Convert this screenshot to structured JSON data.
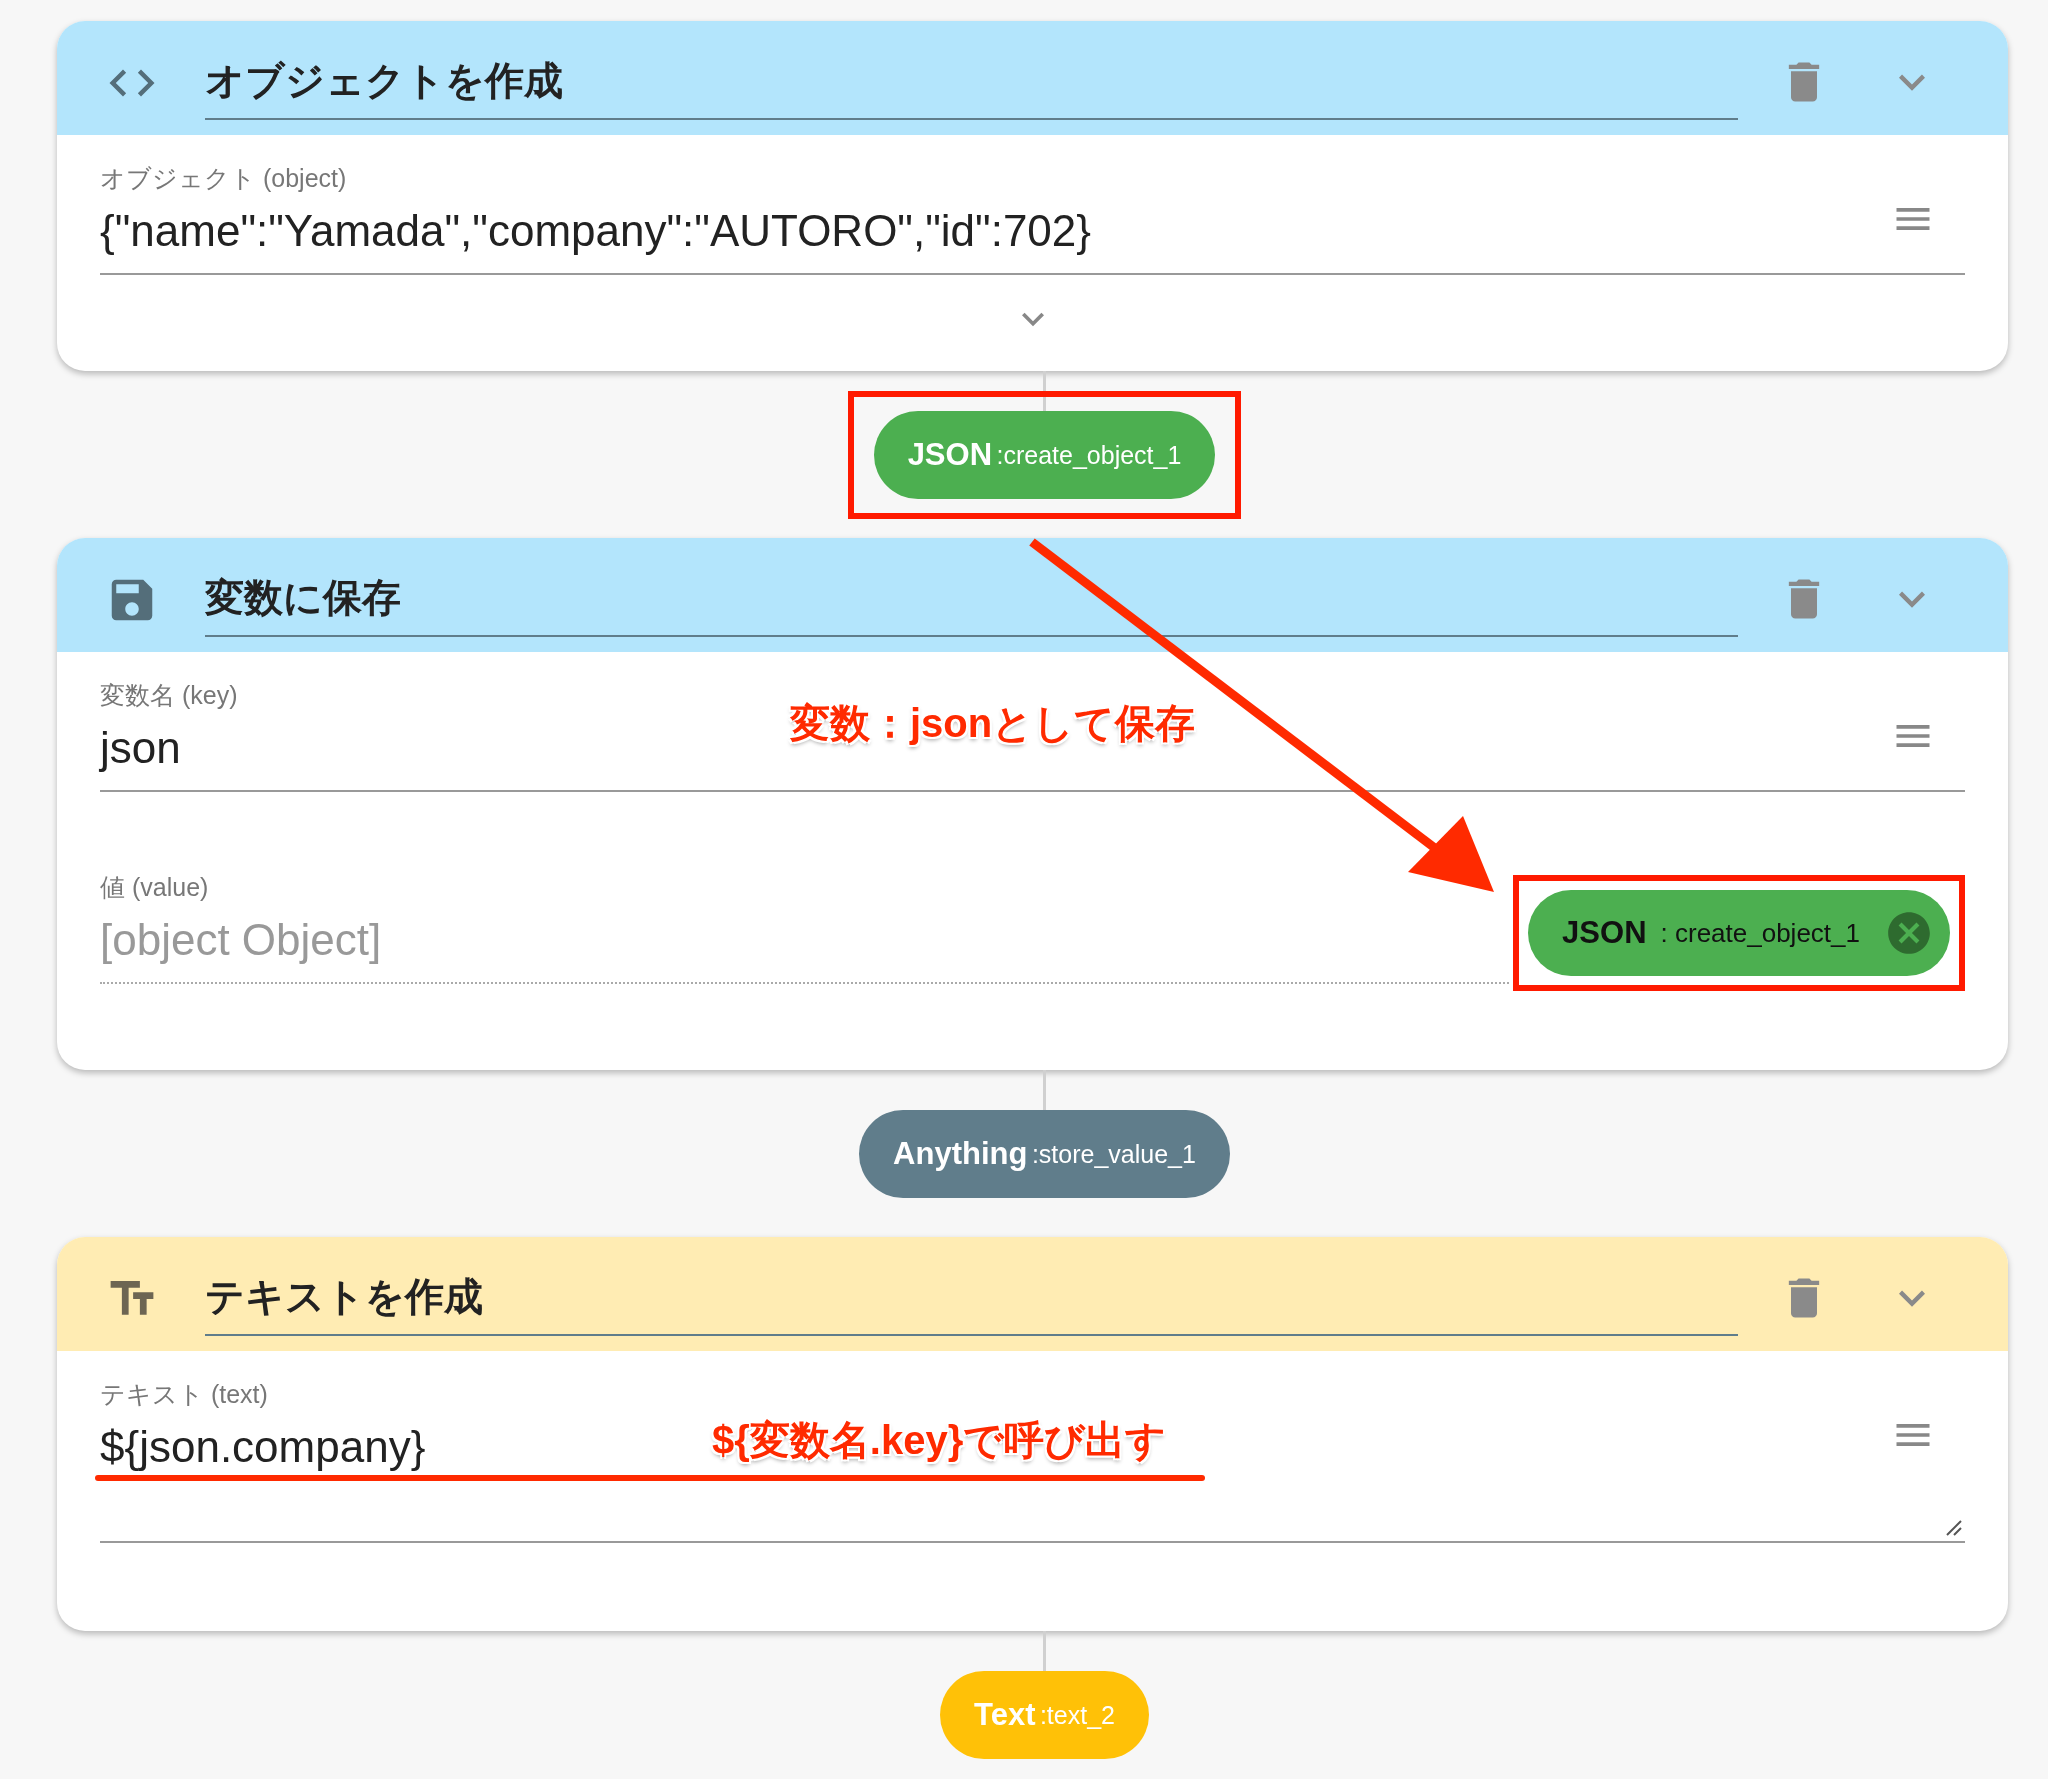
{
  "blocks": [
    {
      "kind": "code",
      "title": "オブジェクトを作成",
      "expandable": true,
      "fields": [
        {
          "kind": "input",
          "label": "オブジェクト (object)",
          "value": "{\"name\":\"Yamada\",\"company\":\"AUTORO\",\"id\":702}"
        }
      ],
      "output": {
        "type": "JSON",
        "name": ":create_object_1",
        "color": "#4caf50",
        "highlighted": true
      }
    },
    {
      "kind": "save",
      "title": "変数に保存",
      "fields": [
        {
          "kind": "input",
          "label": "変数名 (key)",
          "value": "json",
          "annotation": {
            "text": "変数：jsonとして保存"
          }
        },
        {
          "kind": "reference",
          "label": "値 (value)",
          "placeholder": "[object Object]",
          "chip": {
            "type": "JSON",
            "name": ": create_object_1",
            "highlighted": true
          }
        }
      ],
      "output": {
        "type": "Anything",
        "name": ":store_value_1",
        "color": "#607d8b",
        "highlighted": false
      }
    },
    {
      "kind": "text",
      "title": "テキストを作成",
      "fields": [
        {
          "kind": "textarea",
          "label": "テキスト (text)",
          "value": "${json.company}",
          "annotation": {
            "text": "${変数名.key}で呼び出す",
            "underline": true
          }
        }
      ],
      "output": {
        "type": "Text",
        "name": ":text_2",
        "color": "#ffc107",
        "highlighted": false
      }
    }
  ]
}
